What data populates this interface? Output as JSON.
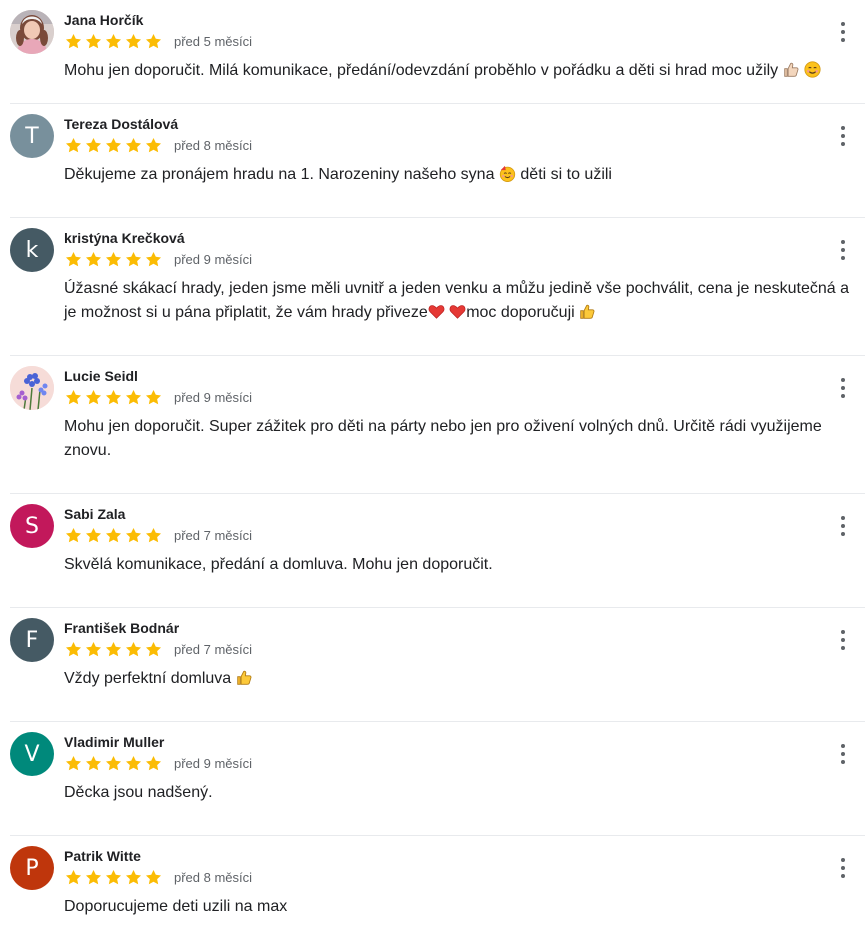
{
  "reviews": [
    {
      "name": "Jana Horčík",
      "date": "před 5 měsíci",
      "rating": 5,
      "avatar": {
        "type": "photo",
        "icon": "person-photo-icon",
        "bg": "#c9b7b3"
      },
      "text": "Mohu jen doporučit. Milá komunikace, předání/odevzdání proběhlo v pořádku a děti si hrad moc užily",
      "emojis": [
        "thumbs-up-light-icon",
        "smile-icon"
      ]
    },
    {
      "name": "Tereza Dostálová",
      "date": "před 8 měsíci",
      "rating": 5,
      "avatar": {
        "type": "letter",
        "letter": "T",
        "bg": "#78909c"
      },
      "text": "Děkujeme za pronájem hradu na 1. Narozeniny našeho syna",
      "text2": "děti si to užili",
      "emojis": [
        "party-face-icon"
      ]
    },
    {
      "name": "kristýna Krečková",
      "date": "před 9 měsíci",
      "rating": 5,
      "avatar": {
        "type": "letter",
        "letter": "k",
        "bg": "#455a64"
      },
      "text": "Úžasné skákací hrady, jeden jsme měli uvnitř a jeden venku a můžu jedině vše pochválit, cena je neskutečná a je možnost si u pána připlatit, že vám hrady přiveze",
      "text2": "moc doporučuji",
      "emojis": [
        "heart-icon",
        "heart-icon",
        "thumbs-up-icon"
      ]
    },
    {
      "name": "Lucie Seidl",
      "date": "před 9 měsíci",
      "rating": 5,
      "avatar": {
        "type": "photo",
        "icon": "flowers-photo-icon",
        "bg": "#f3d9d6"
      },
      "text": "Mohu jen doporučit. Super zážitek pro děti na párty nebo jen pro oživení volných dnů. Určitě rádi využijeme znovu."
    },
    {
      "name": "Sabi Zala",
      "date": "před 7 měsíci",
      "rating": 5,
      "avatar": {
        "type": "letter",
        "letter": "S",
        "bg": "#c2185b"
      },
      "text": "Skvělá komunikace, předání a domluva. Mohu jen doporučit."
    },
    {
      "name": "František Bodnár",
      "date": "před 7 měsíci",
      "rating": 5,
      "avatar": {
        "type": "letter",
        "letter": "F",
        "bg": "#455a64"
      },
      "text": "Vždy perfektní domluva",
      "emojis": [
        "thumbs-up-icon"
      ]
    },
    {
      "name": "Vladimir Muller",
      "date": "před 9 měsíci",
      "rating": 5,
      "avatar": {
        "type": "letter",
        "letter": "V",
        "bg": "#00897b"
      },
      "text": "Děcka jsou nadšený."
    },
    {
      "name": "Patrik Witte",
      "date": "před 8 měsíci",
      "rating": 5,
      "avatar": {
        "type": "letter",
        "letter": "P",
        "bg": "#bf360c"
      },
      "text": "Doporucujeme deti uzili na max"
    }
  ],
  "colors": {
    "star": "#fbbc04",
    "text": "#202124",
    "muted": "#5f6368",
    "divider": "#e8eaed"
  }
}
